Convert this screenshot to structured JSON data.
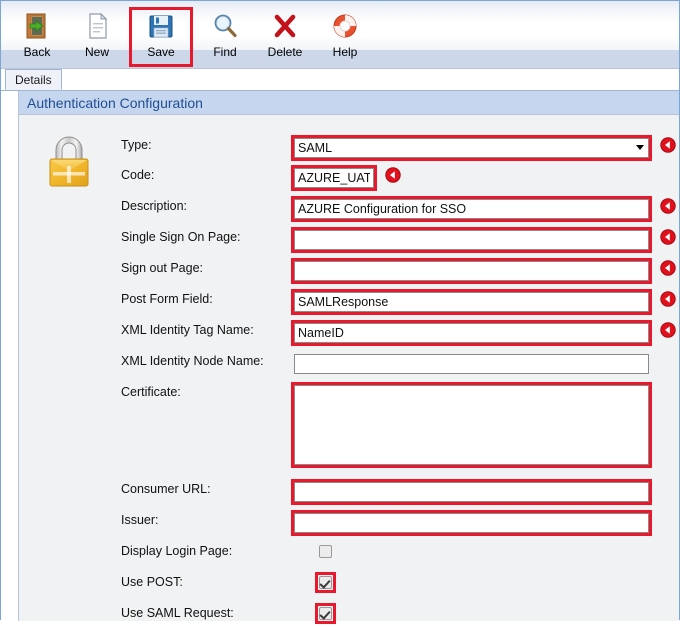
{
  "toolbar": {
    "buttons": [
      {
        "label": "Back",
        "icon": "door-back-icon"
      },
      {
        "label": "New",
        "icon": "new-document-icon"
      },
      {
        "label": "Save",
        "icon": "floppy-disk-save-icon",
        "highlighted": true
      },
      {
        "label": "Find",
        "icon": "magnifier-find-icon"
      },
      {
        "label": "Delete",
        "icon": "red-x-delete-icon"
      },
      {
        "label": "Help",
        "icon": "lifering-help-icon"
      }
    ]
  },
  "tabs": [
    {
      "label": "Details",
      "active": true
    }
  ],
  "panel": {
    "title": "Authentication Configuration",
    "icon": "padlock-icon"
  },
  "form": {
    "fields": [
      {
        "label": "Type:",
        "kind": "select",
        "value": "SAML",
        "options": [
          "SAML"
        ],
        "required_marker": true,
        "highlighted": true,
        "name": "type"
      },
      {
        "label": "Code:",
        "kind": "text",
        "value": "AZURE_UAT",
        "placeholder": "",
        "required_marker": true,
        "highlighted": true,
        "name": "code"
      },
      {
        "label": "Description:",
        "kind": "text",
        "value": "AZURE Configuration for SSO",
        "placeholder": "",
        "required_marker": true,
        "highlighted": true,
        "name": "description"
      },
      {
        "label": "Single Sign On Page:",
        "kind": "text",
        "value": "",
        "placeholder": "",
        "required_marker": true,
        "highlighted": true,
        "name": "single-sign-on-page"
      },
      {
        "label": "Sign out Page:",
        "kind": "text",
        "value": "",
        "placeholder": "",
        "required_marker": true,
        "highlighted": true,
        "name": "sign-out-page"
      },
      {
        "label": "Post Form Field:",
        "kind": "text",
        "value": "SAMLResponse",
        "placeholder": "",
        "required_marker": true,
        "highlighted": true,
        "name": "post-form-field"
      },
      {
        "label": "XML Identity Tag Name:",
        "kind": "text",
        "value": "NameID",
        "placeholder": "",
        "required_marker": true,
        "highlighted": true,
        "name": "xml-identity-tag-name"
      },
      {
        "label": "XML Identity Node Name:",
        "kind": "text",
        "value": "",
        "placeholder": "",
        "required_marker": false,
        "highlighted": false,
        "name": "xml-identity-node-name"
      },
      {
        "label": "Certificate:",
        "kind": "textarea",
        "value": "",
        "placeholder": "",
        "required_marker": false,
        "highlighted": true,
        "name": "certificate"
      },
      {
        "label": "Consumer URL:",
        "kind": "text",
        "value": "",
        "placeholder": "",
        "required_marker": false,
        "highlighted": true,
        "name": "consumer-url"
      },
      {
        "label": "Issuer:",
        "kind": "text",
        "value": "",
        "placeholder": "",
        "required_marker": false,
        "highlighted": true,
        "name": "issuer"
      },
      {
        "label": "Display Login Page:",
        "kind": "checkbox",
        "checked": false,
        "required_marker": false,
        "highlighted": false,
        "name": "display-login-page"
      },
      {
        "label": "Use POST:",
        "kind": "checkbox",
        "checked": true,
        "required_marker": false,
        "highlighted": true,
        "name": "use-post"
      },
      {
        "label": "Use SAML Request:",
        "kind": "checkbox",
        "checked": true,
        "required_marker": false,
        "highlighted": true,
        "name": "use-saml-request"
      }
    ]
  },
  "colors": {
    "highlight_red": "#e8192c",
    "panel_header_bg": "#c6d6ee",
    "panel_header_text": "#1f4e96",
    "toolbar_strip": "#ccd8ea",
    "panel_bg": "#f1f2f4"
  }
}
